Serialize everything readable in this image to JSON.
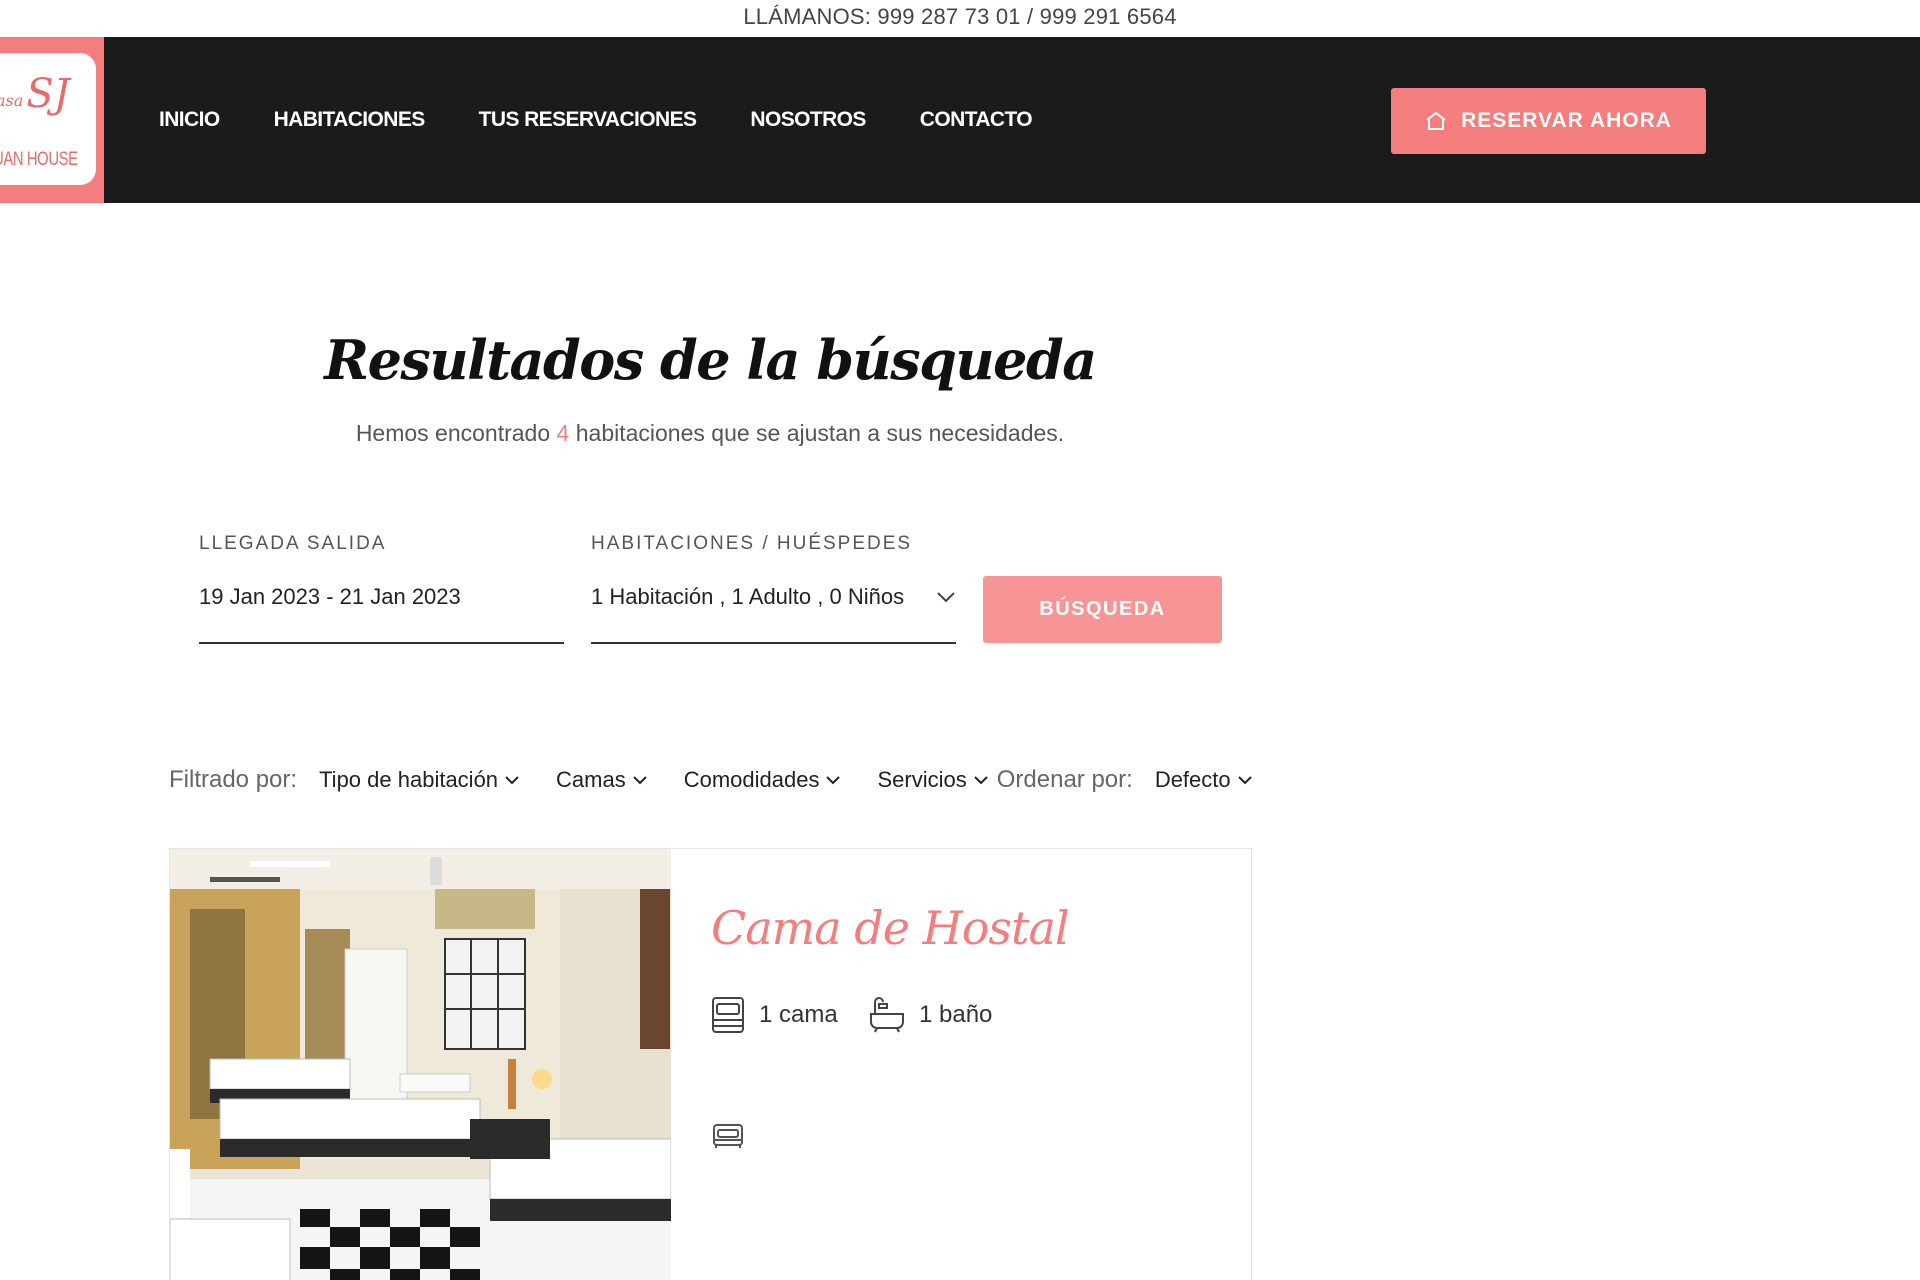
{
  "topbar": {
    "phone_text": "LLÁMANOS: 999 287 73 01 / 999 291 6564"
  },
  "logo": {
    "script": "SJ",
    "small": "asa",
    "name": "JUAN HOUSE"
  },
  "nav": {
    "items": [
      "INICIO",
      "HABITACIONES",
      "TUS RESERVACIONES",
      "NOSOTROS",
      "CONTACTO"
    ],
    "cta_label": "RESERVAR AHORA"
  },
  "results": {
    "title": "Resultados de la búsqueda",
    "subtitle_prefix": "Hemos encontrado ",
    "count": "4",
    "subtitle_suffix": " habitaciones que se ajustan a sus necesidades."
  },
  "search": {
    "dates_label": "LLEGADA SALIDA",
    "dates_value": "19 Jan 2023 - 21 Jan 2023",
    "guests_label": "HABITACIONES / HUÉSPEDES",
    "guests_value": "1 Habitación , 1 Adulto , 0 Niños",
    "button_label": "BÚSQUEDA"
  },
  "filters": {
    "filter_label": "Filtrado por:",
    "options": [
      "Tipo de habitación",
      "Camas",
      "Comodidades",
      "Servicios"
    ],
    "sort_label": "Ordenar por:",
    "sort_value": "Defecto"
  },
  "room": {
    "name": "Cama de Hostal",
    "beds": "1 cama",
    "baths": "1 baño"
  },
  "colors": {
    "accent": "#f47d7d",
    "header_bg": "#1c1b1b",
    "button_light": "#f79596"
  }
}
